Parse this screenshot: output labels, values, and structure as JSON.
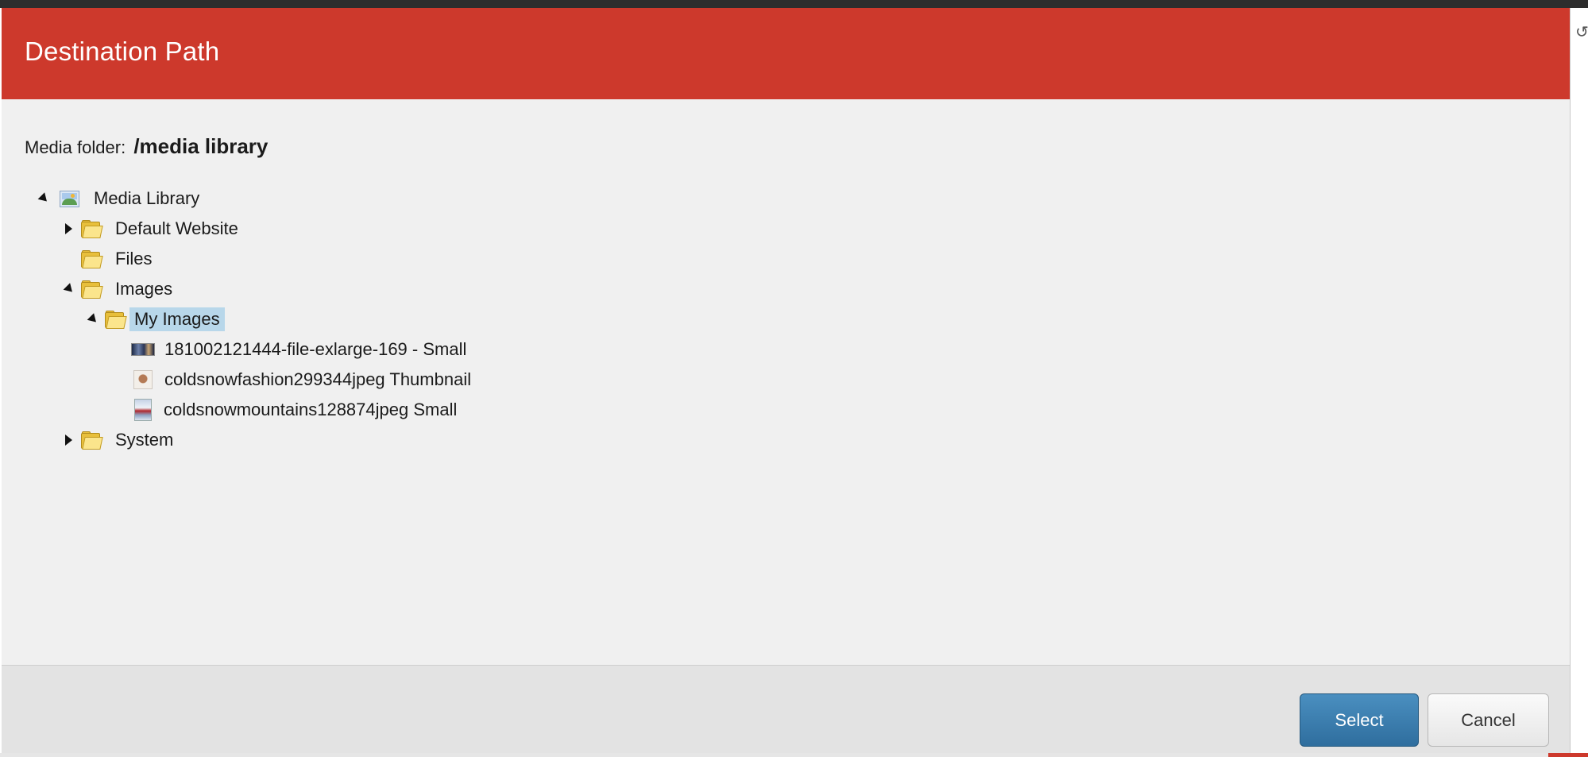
{
  "dialog": {
    "title": "Destination Path",
    "media_folder_label": "Media folder:",
    "media_folder_path": "/media library"
  },
  "tree": {
    "root": {
      "label": "Media Library",
      "icon": "media-library-icon",
      "expanded": true
    },
    "default_website": {
      "label": "Default Website",
      "icon": "folder-icon",
      "expanded": false
    },
    "files": {
      "label": "Files",
      "icon": "folder-icon"
    },
    "images": {
      "label": "Images",
      "icon": "folder-icon",
      "expanded": true
    },
    "my_images": {
      "label": "My Images",
      "icon": "folder-icon",
      "expanded": true,
      "selected": true
    },
    "items": [
      {
        "label": "181002121444-file-exlarge-169 - Small",
        "icon": "image-thumbnail-icon"
      },
      {
        "label": "coldsnowfashion299344jpeg Thumbnail",
        "icon": "image-thumbnail-icon"
      },
      {
        "label": "coldsnowmountains128874jpeg Small",
        "icon": "image-thumbnail-icon"
      }
    ],
    "system": {
      "label": "System",
      "icon": "folder-icon",
      "expanded": false
    }
  },
  "footer": {
    "select_label": "Select",
    "cancel_label": "Cancel"
  },
  "colors": {
    "header": "#cd392c",
    "selection": "#b8d7ea",
    "primary_button": "#3a7fb1"
  }
}
